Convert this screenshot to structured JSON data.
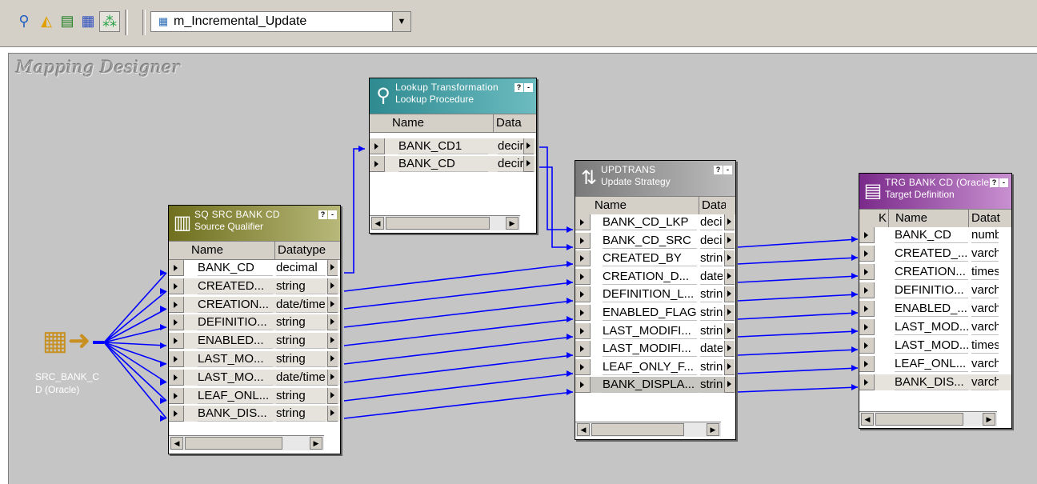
{
  "toolbar": {
    "buttons": [
      "find-in-workspace-icon",
      "source-analyzer-icon",
      "target-designer-icon",
      "transformation-developer-icon",
      "mapping-designer-icon"
    ],
    "mapping_selector_value": "m_Incremental_Update"
  },
  "canvas": {
    "title": "Mapping Designer"
  },
  "source": {
    "label": "SRC_BANK_C D (Oracle)"
  },
  "source_qualifier": {
    "title": "SQ SRC BANK CD",
    "subtitle": "Source Qualifier",
    "columns": [
      "Name",
      "Datatype"
    ],
    "rows": [
      {
        "name": "BANK_CD",
        "type": "decimal"
      },
      {
        "name": "CREATED...",
        "type": "string"
      },
      {
        "name": "CREATION...",
        "type": "date/time"
      },
      {
        "name": "DEFINITIO...",
        "type": "string"
      },
      {
        "name": "ENABLED...",
        "type": "string"
      },
      {
        "name": "LAST_MO...",
        "type": "string"
      },
      {
        "name": "LAST_MO...",
        "type": "date/time"
      },
      {
        "name": "LEAF_ONL...",
        "type": "string"
      },
      {
        "name": "BANK_DIS...",
        "type": "string"
      }
    ]
  },
  "lookup": {
    "title": "Lookup Transformation",
    "subtitle": "Lookup Procedure",
    "columns": [
      "Name",
      "Data"
    ],
    "rows": [
      {
        "name": "BANK_CD1",
        "type": "decir"
      },
      {
        "name": "BANK_CD",
        "type": "decir"
      }
    ]
  },
  "update_strategy": {
    "title": "UPDTRANS",
    "subtitle": "Update Strategy",
    "columns": [
      "Name",
      "Data"
    ],
    "rows": [
      {
        "name": "BANK_CD_LKP",
        "type": "decir"
      },
      {
        "name": "BANK_CD_SRC",
        "type": "decir"
      },
      {
        "name": "CREATED_BY",
        "type": "string"
      },
      {
        "name": "CREATION_D...",
        "type": "date"
      },
      {
        "name": "DEFINITION_L...",
        "type": "string"
      },
      {
        "name": "ENABLED_FLAG",
        "type": "string"
      },
      {
        "name": "LAST_MODIFI...",
        "type": "string"
      },
      {
        "name": "LAST_MODIFI...",
        "type": "date"
      },
      {
        "name": "LEAF_ONLY_F...",
        "type": "string"
      },
      {
        "name": "BANK_DISPLA...",
        "type": "string"
      }
    ]
  },
  "target": {
    "title": "TRG BANK CD (Oracle)",
    "subtitle": "Target Definition",
    "columns": [
      "K",
      "Name",
      "Dataty"
    ],
    "rows": [
      {
        "name": "BANK_CD",
        "type": "numbe"
      },
      {
        "name": "CREATED_...",
        "type": "varch"
      },
      {
        "name": "CREATION...",
        "type": "timest"
      },
      {
        "name": "DEFINITIO...",
        "type": "varch"
      },
      {
        "name": "ENABLED_...",
        "type": "varch"
      },
      {
        "name": "LAST_MOD...",
        "type": "varch"
      },
      {
        "name": "LAST_MOD...",
        "type": "timest"
      },
      {
        "name": "LEAF_ONL...",
        "type": "varch"
      },
      {
        "name": "BANK_DIS...",
        "type": "varch"
      }
    ]
  },
  "colors": {
    "link": "#0000ff",
    "sq_header": "#8b8b2a",
    "lookup_header": "#3c9aa0",
    "update_header": "#9a9a9a",
    "target_header": "#8a3c9a",
    "canvas": "#c5c5c5"
  }
}
